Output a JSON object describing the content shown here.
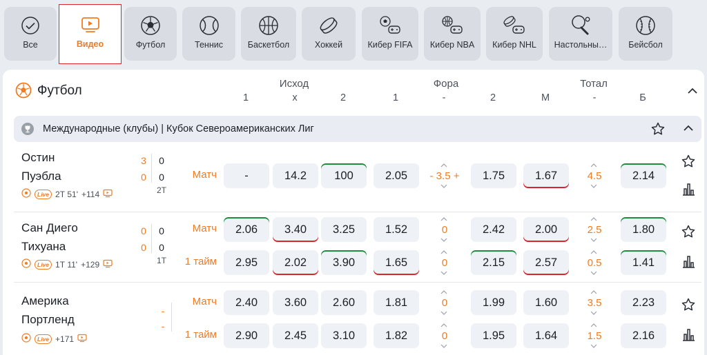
{
  "tabs": [
    {
      "label": "Все",
      "icon": "check-circle-icon"
    },
    {
      "label": "Видео",
      "icon": "tv-icon"
    },
    {
      "label": "Футбол",
      "icon": "soccer-ball-icon"
    },
    {
      "label": "Теннис",
      "icon": "tennis-ball-icon"
    },
    {
      "label": "Баскетбол",
      "icon": "basketball-icon"
    },
    {
      "label": "Хоккей",
      "icon": "hockey-puck-icon"
    },
    {
      "label": "Кибер FIFA",
      "icon": "gamepad-soccer-icon"
    },
    {
      "label": "Кибер NBA",
      "icon": "gamepad-basketball-icon"
    },
    {
      "label": "Кибер NHL",
      "icon": "gamepad-hockey-icon"
    },
    {
      "label": "Настольны…",
      "icon": "table-tennis-icon"
    },
    {
      "label": "Бейсбол",
      "icon": "baseball-icon"
    }
  ],
  "sport": {
    "title": "Футбол",
    "groups": {
      "outcome": "Исход",
      "handicap": "Фора",
      "total": "Тотал"
    },
    "columns": [
      "1",
      "x",
      "2",
      "1",
      "-",
      "2",
      "М",
      "-",
      "Б"
    ]
  },
  "league": {
    "name": "Международные (клубы) | Кубок Североамериканских Лиг"
  },
  "matches": [
    {
      "team1": "Остин",
      "team2": "Пуэбла",
      "s1a": "3",
      "s1b": "0",
      "s2a": "0",
      "s2b": "0",
      "period": "2Т",
      "meta": {
        "time": "2Т 51'",
        "more": "+114",
        "live": "Live"
      },
      "rows": [
        {
          "label": "Матч",
          "odds": [
            "-",
            "14.2",
            "100",
            "2.05",
            "- 3.5 +",
            "1.75",
            "1.67",
            "4.5",
            "2.14"
          ]
        }
      ]
    },
    {
      "team1": "Сан Диего",
      "team2": "Тихуана",
      "s1a": "0",
      "s1b": "0",
      "s2a": "0",
      "s2b": "0",
      "period": "1Т",
      "meta": {
        "time": "1Т 11'",
        "more": "+129",
        "live": "Live"
      },
      "rows": [
        {
          "label": "Матч",
          "odds": [
            "2.06",
            "3.40",
            "3.25",
            "1.52",
            "0",
            "2.42",
            "2.00",
            "2.5",
            "1.80"
          ]
        },
        {
          "label": "1 тайм",
          "odds": [
            "2.95",
            "2.02",
            "3.90",
            "1.65",
            "0",
            "2.15",
            "2.57",
            "0.5",
            "1.41"
          ]
        }
      ]
    },
    {
      "team1": "Америка",
      "team2": "Портленд",
      "s1a": "-",
      "s2a": "-",
      "meta": {
        "more": "+171",
        "live": "Live"
      },
      "rows": [
        {
          "label": "Матч",
          "odds": [
            "2.40",
            "3.60",
            "2.60",
            "1.81",
            "0",
            "1.99",
            "1.60",
            "3.5",
            "2.23"
          ]
        },
        {
          "label": "1 тайм",
          "odds": [
            "2.90",
            "2.45",
            "3.10",
            "1.82",
            "0",
            "1.95",
            "1.64",
            "1.5",
            "2.16"
          ]
        }
      ]
    }
  ],
  "colors": {
    "accent": "#f07b23",
    "up": "#1f8a3b",
    "down": "#d8252b"
  }
}
